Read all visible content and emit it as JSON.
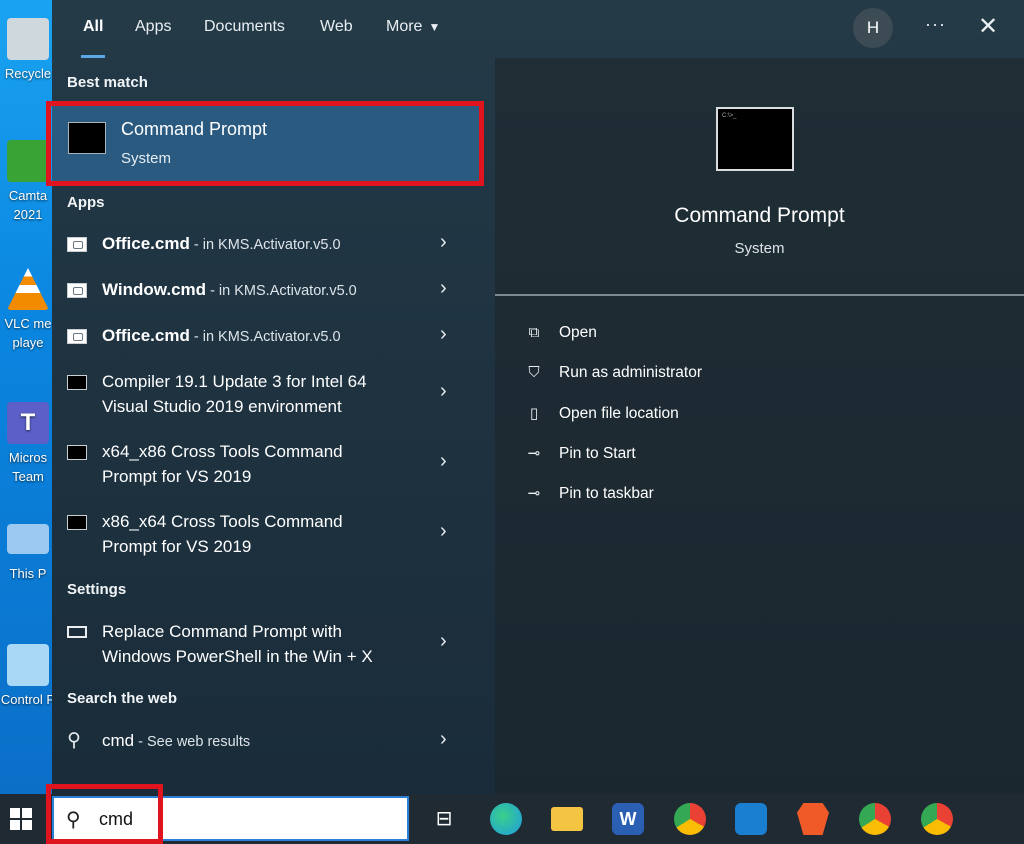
{
  "desktop": {
    "icons": [
      {
        "label": "Recycle",
        "color": "#cfd8dc"
      },
      {
        "label": "Camta 2021",
        "color": "#3aa335"
      },
      {
        "label": "VLC me playe",
        "color": "#f28b00"
      },
      {
        "label": "Micros Team",
        "color": "#5b5fc7"
      },
      {
        "label": "This P",
        "color": "#9cc9ef"
      },
      {
        "label": "Control P",
        "color": "#a8d8f5"
      }
    ]
  },
  "tabs": [
    {
      "label": "All"
    },
    {
      "label": "Apps"
    },
    {
      "label": "Documents"
    },
    {
      "label": "Web"
    },
    {
      "label": "More"
    }
  ],
  "header": {
    "avatar_letter": "H",
    "more_options": "···",
    "close": "✕"
  },
  "best_match": {
    "section": "Best match",
    "title": "Command Prompt",
    "subtitle": "System"
  },
  "apps_section": "Apps",
  "apps": [
    {
      "name": "Office.cmd",
      "suffix": " - in KMS.Activator.v5.0",
      "icon": "batch-file-icon"
    },
    {
      "name": "Window.cmd",
      "suffix": " - in KMS.Activator.v5.0",
      "icon": "batch-file-icon"
    },
    {
      "name": "Office.cmd",
      "suffix": " - in KMS.Activator.v5.0",
      "icon": "batch-file-icon"
    },
    {
      "line1": "Compiler 19.1 Update 3 for Intel 64",
      "line2": "Visual Studio 2019 environment",
      "icon": "console-icon"
    },
    {
      "line1": "x64_x86 Cross Tools Command",
      "line2": "Prompt for VS 2019",
      "icon": "console-icon"
    },
    {
      "line1": "x86_x64 Cross Tools Command",
      "line2": "Prompt for VS 2019",
      "icon": "console-icon"
    }
  ],
  "settings_section": "Settings",
  "settings": {
    "line1": "Replace Command Prompt with",
    "line2": "Windows PowerShell in the Win + X"
  },
  "web_section": "Search the web",
  "web": {
    "query": "cmd",
    "suffix": " - See web results"
  },
  "preview": {
    "title": "Command Prompt",
    "subtitle": "System",
    "actions": [
      {
        "label": "Open",
        "icon": "open-icon"
      },
      {
        "label": "Run as administrator",
        "icon": "shield-icon"
      },
      {
        "label": "Open file location",
        "icon": "file-location-icon"
      },
      {
        "label": "Pin to Start",
        "icon": "pin-icon"
      },
      {
        "label": "Pin to taskbar",
        "icon": "pin-icon"
      }
    ]
  },
  "taskbar": {
    "search_value": "cmd",
    "apps": [
      {
        "name": "task-view-icon"
      },
      {
        "name": "edge-icon",
        "color": "#1f9be0"
      },
      {
        "name": "file-explorer-icon",
        "color": "#f4c542"
      },
      {
        "name": "word-icon",
        "color": "#2b5fb4"
      },
      {
        "name": "chrome-icon",
        "color": "#e94235"
      },
      {
        "name": "outlook-icon",
        "color": "#1a7fd0"
      },
      {
        "name": "brave-icon",
        "color": "#f05a28"
      },
      {
        "name": "chrome-profile-m-icon",
        "color": "#e94235"
      },
      {
        "name": "chrome-profile-h-icon",
        "color": "#e94235"
      }
    ]
  }
}
